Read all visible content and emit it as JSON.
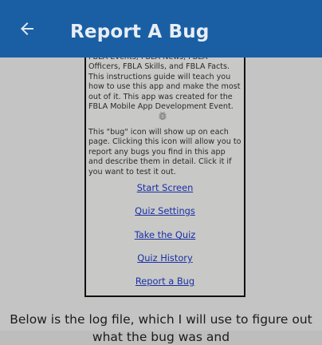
{
  "appbar": {
    "title": "Report A Bug",
    "back_icon": "arrow-back-icon"
  },
  "guide": {
    "paragraph1": "FBLA Events, FBLA News, FBLA Officers, FBLA Skills, and FBLA Facts. This instructions guide will teach you how to use this app and make the most out of it. This app was created for the FBLA Mobile App Development Event.",
    "bug_icon": "bug-icon",
    "paragraph2": "This \"bug\" icon will show up on each page. Clicking this icon will allow you to report any bugs you find in this app and describe them in detail. Click it if you want to test it out.",
    "links": [
      "Start Screen",
      "Quiz Settings",
      "Take the Quiz",
      "Quiz History",
      "Report a Bug"
    ]
  },
  "footer": {
    "line1": "Below is the log file, which I will use to figure out",
    "line2": "what the bug was and"
  },
  "colors": {
    "appbar": "#1a5fa3",
    "link": "#1a2fa6",
    "background": "#c4c4c4"
  }
}
